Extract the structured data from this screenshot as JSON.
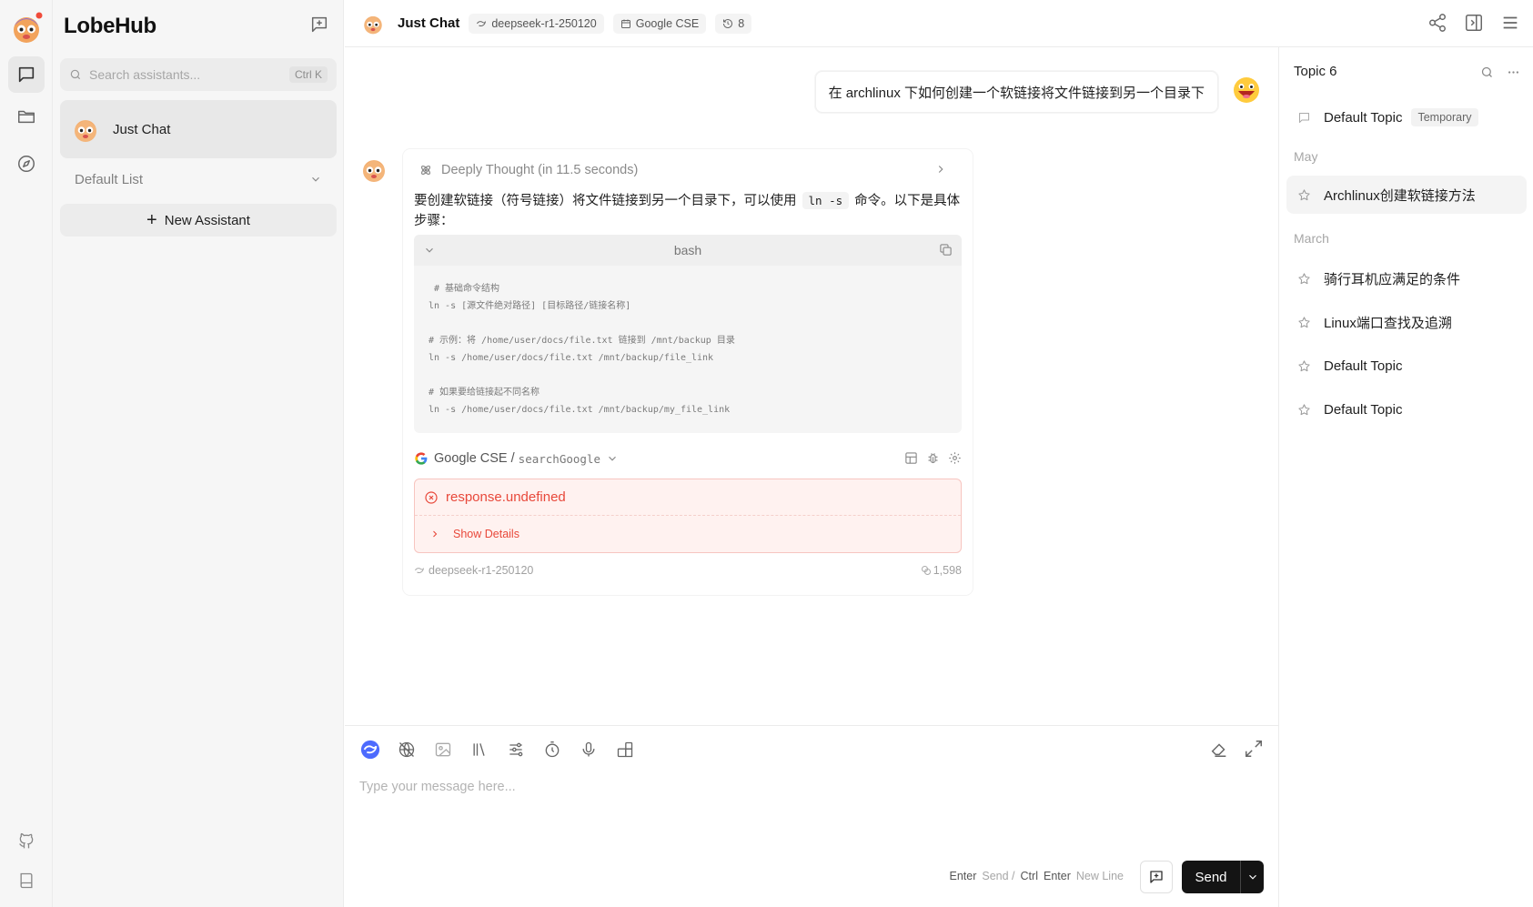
{
  "app": {
    "brand": "LobeHub",
    "accent": "#141414",
    "error_color": "#e8483a"
  },
  "rail": {
    "items": [
      {
        "name": "chat-icon",
        "active": true
      },
      {
        "name": "folder-icon",
        "active": false
      },
      {
        "name": "compass-icon",
        "active": false
      }
    ],
    "bottom": [
      "github-icon",
      "book-icon"
    ]
  },
  "sidebar": {
    "search_placeholder": "Search assistants...",
    "search_shortcut": "Ctrl K",
    "agent_name": "Just Chat",
    "default_list": "Default List",
    "new_assistant": "New Assistant"
  },
  "header": {
    "title": "Just Chat",
    "model": "deepseek-r1-250120",
    "plugin": "Google CSE",
    "history_count": "8"
  },
  "chat": {
    "user_message": "在 archlinux 下如何创建一个软链接将文件链接到另一个目录下",
    "thought_label": "Deeply Thought (in 11.5 seconds)",
    "answer_prefix": "要创建软链接（符号链接）将文件链接到另一个目录下，可以使用",
    "inline_code": "ln -s",
    "answer_suffix": "命令。以下是具体步骤：",
    "code_lang": "bash",
    "code_lines": [
      " # 基础命令结构",
      "ln -s [源文件绝对路径] [目标路径/链接名称]",
      "",
      "# 示例：将 /home/user/docs/file.txt 链接到 /mnt/backup 目录",
      "ln -s /home/user/docs/file.txt /mnt/backup/file_link",
      "",
      "# 如果要给链接起不同名称",
      "ln -s /home/user/docs/file.txt /mnt/backup/my_file_link"
    ],
    "tool_plugin": "Google CSE /",
    "tool_api": "searchGoogle",
    "error_text": "response.undefined",
    "show_details": "Show Details",
    "footer_model": "deepseek-r1-250120",
    "footer_tokens": "1,598"
  },
  "input": {
    "placeholder": "Type your message here...",
    "hint_enter": "Enter",
    "hint_send": "Send /",
    "hint_ctrl": "Ctrl",
    "hint_enter2": "Enter",
    "hint_newline": "New Line",
    "send_label": "Send"
  },
  "topics": {
    "title": "Topic 6",
    "current": {
      "label": "Default Topic",
      "tag": "Temporary"
    },
    "groups": [
      {
        "label": "May",
        "items": [
          "Archlinux创建软链接方法"
        ]
      },
      {
        "label": "March",
        "items": [
          "骑行耳机应满足的条件",
          "Linux端口查找及追溯",
          "Default Topic",
          "Default Topic"
        ]
      }
    ]
  }
}
